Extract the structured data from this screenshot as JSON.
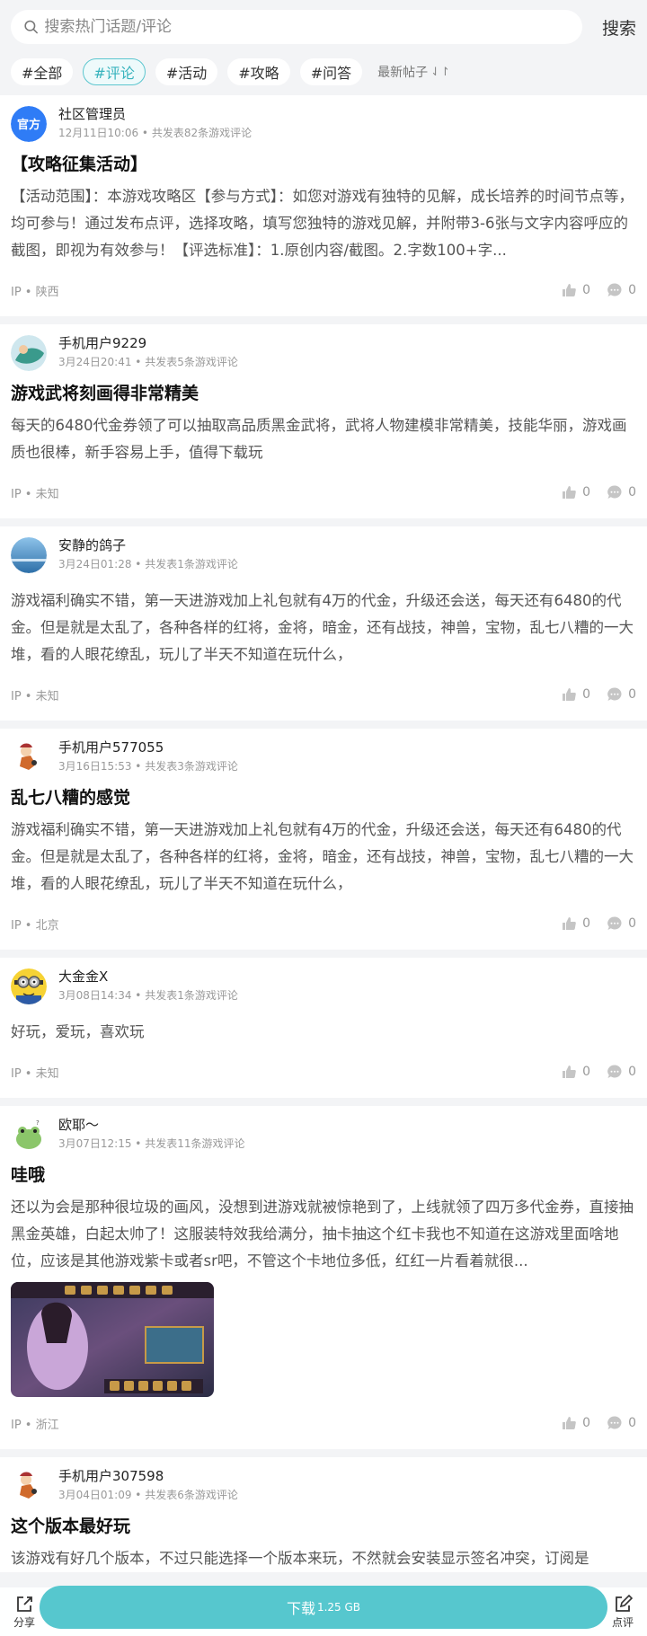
{
  "search": {
    "placeholder": "搜索热门话题/评论",
    "button": "搜索"
  },
  "filters": {
    "chips": [
      "#全部",
      "#评论",
      "#活动",
      "#攻略",
      "#问答"
    ],
    "active_index": 1,
    "sort_label": "最新帖子"
  },
  "accent_color": "#56c7ce",
  "posts": [
    {
      "author": "社区管理员",
      "meta": "12月11日10:06 • 共发表82条游戏评论",
      "title": "【攻略征集活动】",
      "body": "【活动范围】：本游戏攻略区【参与方式】：如您对游戏有独特的见解，成长培养的时间节点等，均可参与！通过发布点评，选择攻略，填写您独特的游戏见解，并附带3-6张与文字内容呼应的截图，即视为有效参与！【评选标准】：1.原创内容/截图。2.字数100+字...",
      "ip": "IP • 陕西",
      "likes": "0",
      "comments": "0"
    },
    {
      "author": "手机用户9229",
      "meta": "3月24日20:41 • 共发表5条游戏评论",
      "title": "游戏武将刻画得非常精美",
      "body": "每天的6480代金券领了可以抽取高品质黑金武将，武将人物建模非常精美，技能华丽，游戏画质也很棒，新手容易上手，值得下载玩",
      "ip": "IP • 未知",
      "likes": "0",
      "comments": "0"
    },
    {
      "author": "安静的鸽子",
      "meta": "3月24日01:28 • 共发表1条游戏评论",
      "title": "",
      "body": "游戏福利确实不错，第一天进游戏加上礼包就有4万的代金，升级还会送，每天还有6480的代金。但是就是太乱了，各种各样的红将，金将，暗金，还有战技，神兽，宝物，乱七八糟的一大堆，看的人眼花缭乱，玩儿了半天不知道在玩什么，",
      "ip": "IP • 未知",
      "likes": "0",
      "comments": "0"
    },
    {
      "author": "手机用户577055",
      "meta": "3月16日15:53 • 共发表3条游戏评论",
      "title": "乱七八糟的感觉",
      "body": "游戏福利确实不错，第一天进游戏加上礼包就有4万的代金，升级还会送，每天还有6480的代金。但是就是太乱了，各种各样的红将，金将，暗金，还有战技，神兽，宝物，乱七八糟的一大堆，看的人眼花缭乱，玩儿了半天不知道在玩什么，",
      "ip": "IP • 北京",
      "likes": "0",
      "comments": "0"
    },
    {
      "author": "大金金X",
      "meta": "3月08日14:34 • 共发表1条游戏评论",
      "title": "",
      "body": "好玩，爱玩，喜欢玩",
      "ip": "IP • 未知",
      "likes": "0",
      "comments": "0"
    },
    {
      "author": "欧耶～",
      "meta": "3月07日12:15 • 共发表11条游戏评论",
      "title": "哇哦",
      "body": "还以为会是那种很垃圾的画风，没想到进游戏就被惊艳到了，上线就领了四万多代金券，直接抽黑金英雄，白起太帅了！这服装特效我给满分，抽卡抽这个红卡我也不知道在这游戏里面啥地位，应该是其他游戏紫卡或者sr吧，不管这个卡地位多低，红红一片看着就很...",
      "ip": "IP • 浙江",
      "likes": "0",
      "comments": "0"
    },
    {
      "author": "手机用户307598",
      "meta": "3月04日01:09 • 共发表6条游戏评论",
      "title": "这个版本最好玩",
      "body": "该游戏有好几个版本，不过只能选择一个版本来玩，不然就会安装显示签名冲突，订阅是",
      "ip": "",
      "likes": "",
      "comments": ""
    }
  ],
  "bottom": {
    "share": "分享",
    "review": "点评",
    "download": "下载",
    "size": "1.25 GB"
  }
}
